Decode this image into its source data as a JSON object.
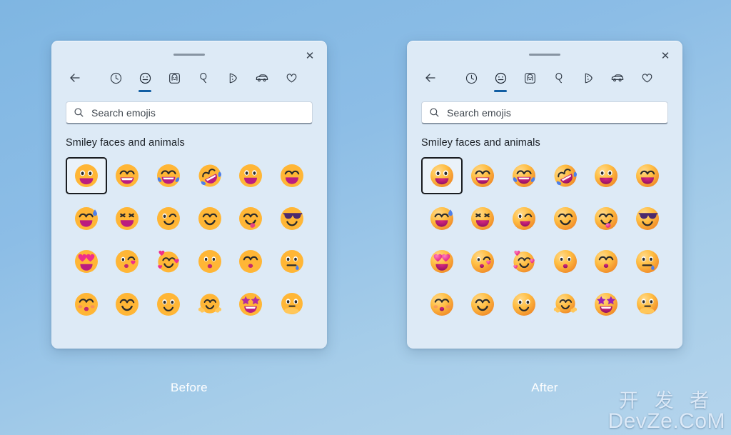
{
  "background": {
    "color_top": "#7fb6e2",
    "color_bottom": "#b4d4ec"
  },
  "accent_color": "#115ea3",
  "panel_color": "#ddeaf6",
  "captions": {
    "before": "Before",
    "after": "After"
  },
  "watermark": {
    "chinese": "开 发 者",
    "latin": "DevZe.CoM"
  },
  "panel": {
    "close_label": "✕",
    "tabs": [
      {
        "name": "back",
        "label": "Back",
        "selected": false
      },
      {
        "name": "recent",
        "label": "Recently used",
        "selected": false
      },
      {
        "name": "emoji",
        "label": "Smiley faces and animals",
        "selected": true
      },
      {
        "name": "people",
        "label": "People",
        "selected": false
      },
      {
        "name": "celebration",
        "label": "Celebration and objects",
        "selected": false
      },
      {
        "name": "food",
        "label": "Food and plants",
        "selected": false
      },
      {
        "name": "transport",
        "label": "Transport and places",
        "selected": false
      },
      {
        "name": "symbols",
        "label": "Symbols",
        "selected": false
      }
    ],
    "search": {
      "placeholder": "Search emojis",
      "value": ""
    },
    "section_title": "Smiley faces and animals",
    "emojis": [
      {
        "name": "grinning-face-big-eyes",
        "selected": true
      },
      {
        "name": "beaming-face-smiling-eyes",
        "selected": false
      },
      {
        "name": "face-with-tears-of-joy",
        "selected": false
      },
      {
        "name": "rolling-on-the-floor-laughing",
        "selected": false
      },
      {
        "name": "grinning-face",
        "selected": false
      },
      {
        "name": "grinning-face-smiling-eyes",
        "selected": false
      },
      {
        "name": "grinning-face-with-sweat",
        "selected": false
      },
      {
        "name": "squinting-face-with-tongue",
        "selected": false
      },
      {
        "name": "winking-face",
        "selected": false
      },
      {
        "name": "smiling-face-smiling-eyes",
        "selected": false
      },
      {
        "name": "face-savoring-food",
        "selected": false
      },
      {
        "name": "smiling-face-with-sunglasses",
        "selected": false
      },
      {
        "name": "smiling-face-with-heart-eyes",
        "selected": false
      },
      {
        "name": "face-blowing-a-kiss",
        "selected": false
      },
      {
        "name": "smiling-face-with-hearts",
        "selected": false
      },
      {
        "name": "kissing-face",
        "selected": false
      },
      {
        "name": "kissing-face-closed-eyes",
        "selected": false
      },
      {
        "name": "drooling-face",
        "selected": false
      },
      {
        "name": "kissing-face-smiling-eyes",
        "selected": false
      },
      {
        "name": "slightly-smiling-face",
        "selected": false
      },
      {
        "name": "neutral-smiling-face",
        "selected": false
      },
      {
        "name": "smiling-face-with-open-hands",
        "selected": false
      },
      {
        "name": "star-struck",
        "selected": false
      },
      {
        "name": "face-with-hand-over-mouth",
        "selected": false
      }
    ]
  }
}
